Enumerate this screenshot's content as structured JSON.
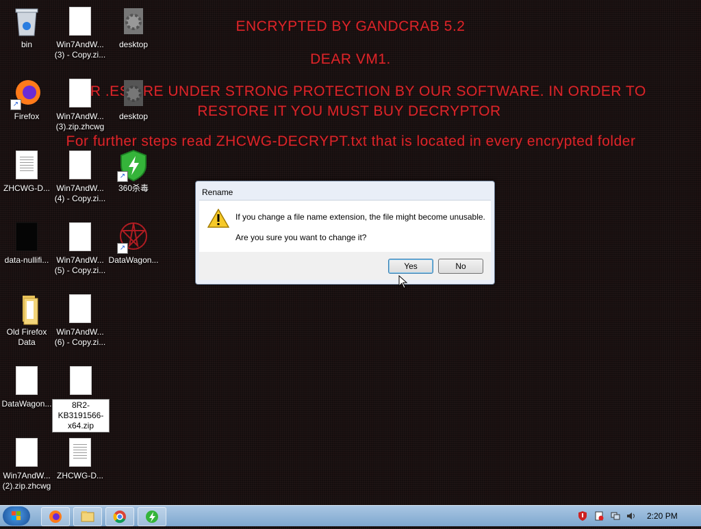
{
  "ransom": {
    "title": "ENCRYPTED BY GANDCRAB 5.2",
    "dear": "DEAR VM1.",
    "line1": "UR   .ES ARE UNDER STRONG PROTECTION BY OUR SOFTWARE. IN ORDER TO",
    "line2": "RESTORE IT YOU MUST BUY DECRYPTOR",
    "line3": "For further steps read ZHCWG-DECRYPT.txt that is located in every encrypted folder",
    "color": "#d9262b"
  },
  "desktop_icons": [
    {
      "label": "bin",
      "icon": "recycle-bin-icon"
    },
    {
      "label": "Win7AndW... (3) - Copy.zi...",
      "icon": "file-icon"
    },
    {
      "label": "desktop",
      "icon": "gear-file-icon"
    },
    {
      "label": "Firefox",
      "icon": "firefox-icon"
    },
    {
      "label": "Win7AndW... (3).zip.zhcwg",
      "icon": "file-icon"
    },
    {
      "label": "desktop",
      "icon": "gear-file-icon"
    },
    {
      "label": "ZHCWG-D...",
      "icon": "text-file-icon"
    },
    {
      "label": "Win7AndW... (4) - Copy.zi...",
      "icon": "file-icon"
    },
    {
      "label": "360杀毒",
      "icon": "shield-icon"
    },
    {
      "label": "data-nullifi...",
      "icon": "black-file-icon"
    },
    {
      "label": "Win7AndW... (5) - Copy.zi...",
      "icon": "file-icon"
    },
    {
      "label": "DataWagon...",
      "icon": "datawagon-icon"
    },
    {
      "label": "Old Firefox Data",
      "icon": "folder-icon"
    },
    {
      "label": "Win7AndW... (6) - Copy.zi...",
      "icon": "file-icon"
    },
    {
      "label": "DataWagon...",
      "icon": "file-icon"
    },
    {
      "label": "8R2- KB3191566- x64.zip",
      "icon": "file-icon"
    },
    {
      "label": "Win7AndW... (2).zip.zhcwg",
      "icon": "file-icon"
    },
    {
      "label": "ZHCWG-D...",
      "icon": "text-file-icon"
    }
  ],
  "dialog": {
    "title": "Rename",
    "message1": "If you change a file name extension, the file might become unusable.",
    "message2": "Are you sure you want to change it?",
    "yes_label": "Yes",
    "no_label": "No"
  },
  "taskbar": {
    "clock": "2:20 PM",
    "pinned": [
      "firefox-icon",
      "explorer-icon",
      "chrome-icon",
      "360-icon"
    ]
  }
}
